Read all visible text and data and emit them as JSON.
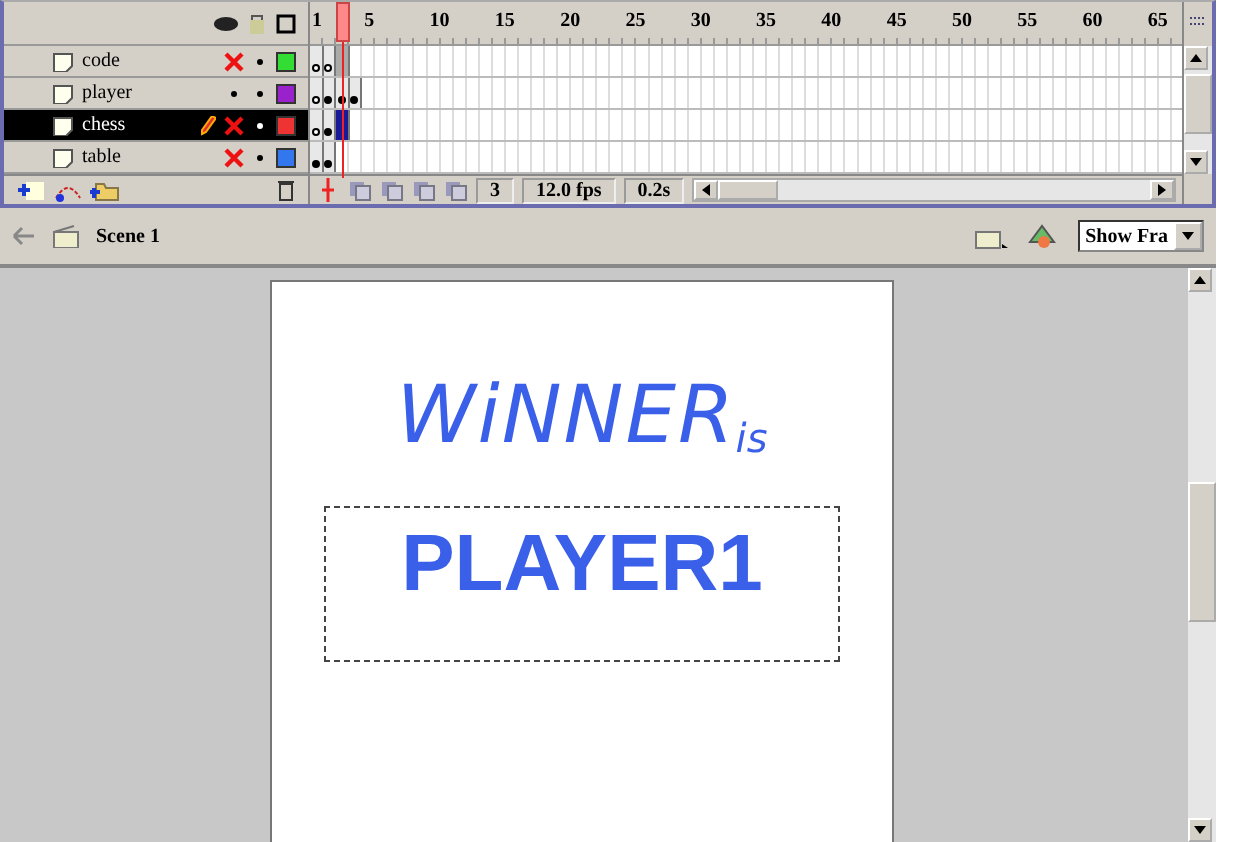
{
  "timeline": {
    "ruler": [
      "1",
      "5",
      "10",
      "15",
      "20",
      "25",
      "30",
      "35",
      "40",
      "45",
      "50",
      "55",
      "60",
      "65"
    ],
    "layers": [
      {
        "name": "code",
        "selected": false,
        "hidden": true,
        "editing": false,
        "color": "#33dd33",
        "frames": [
          {
            "kind": "empty",
            "selected": false
          },
          {
            "kind": "empty",
            "selected": false
          },
          {
            "kind": "plain",
            "selected": false
          }
        ]
      },
      {
        "name": "player",
        "selected": false,
        "hidden": false,
        "editing": false,
        "color": "#9922cc",
        "frames": [
          {
            "kind": "empty",
            "selected": false
          },
          {
            "kind": "filled",
            "selected": false
          },
          {
            "kind": "filled",
            "selected": false
          },
          {
            "kind": "filled",
            "selected": false
          }
        ]
      },
      {
        "name": "chess",
        "selected": true,
        "hidden": true,
        "editing": true,
        "color": "#ee3333",
        "frames": [
          {
            "kind": "empty",
            "selected": false
          },
          {
            "kind": "filled",
            "selected": false
          },
          {
            "kind": "plain",
            "selected": true
          }
        ]
      },
      {
        "name": "table",
        "selected": false,
        "hidden": true,
        "editing": false,
        "color": "#3377ee",
        "frames": [
          {
            "kind": "filled",
            "selected": false
          },
          {
            "kind": "filled",
            "selected": false
          }
        ]
      }
    ],
    "status": {
      "frame": "3",
      "rate": "12.0 fps",
      "time": "0.2s"
    }
  },
  "edit_bar": {
    "scene": "Scene 1",
    "zoom": "Show Fra"
  },
  "stage": {
    "heading": "WiNNER",
    "heading_suffix": "is",
    "text_field": "PLAYER1"
  }
}
